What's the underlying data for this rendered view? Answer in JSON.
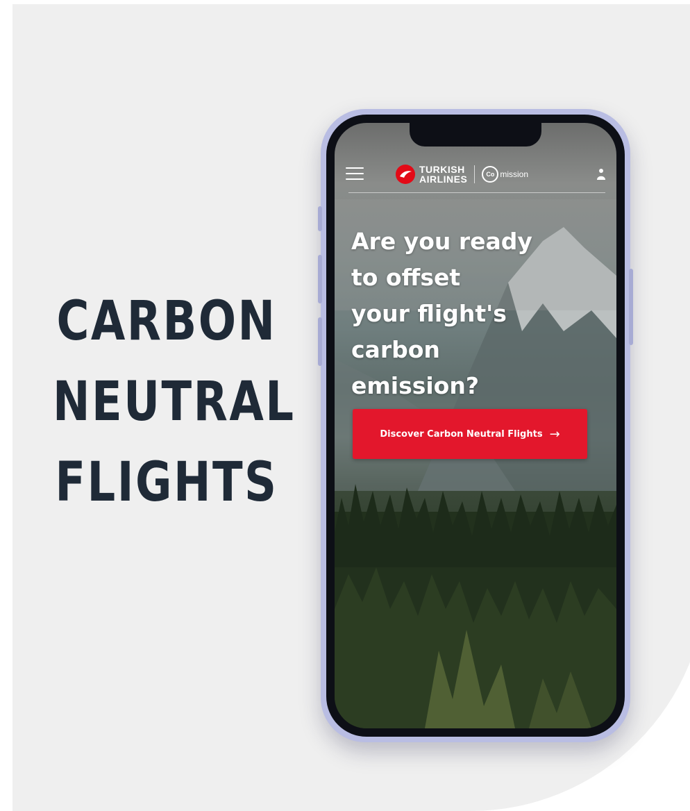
{
  "headline": {
    "line1": "CARBON",
    "line2": "NEUTRAL",
    "line3": "FLIGHTS"
  },
  "app": {
    "brand": {
      "line1": "TURKISH",
      "line2": "AIRLINES",
      "mission_mark": "Co",
      "mission_word": "mission"
    },
    "hero": {
      "line1": "Are you ready",
      "line2": "to offset",
      "line3": "your flight's",
      "line4": "carbon",
      "line5": "emission?"
    },
    "cta_label": "Discover Carbon Neutral Flights",
    "cta_arrow": "→"
  },
  "colors": {
    "brand_red": "#e30a17",
    "cta_red": "#e3172c",
    "headline": "#1f2a37",
    "background": "#efefef",
    "phone_frame": "#b9bde3"
  },
  "icons": [
    "hamburger-menu-icon",
    "turkish-airlines-logo-icon",
    "co-mission-logo-icon",
    "user-icon",
    "arrow-right-icon"
  ]
}
